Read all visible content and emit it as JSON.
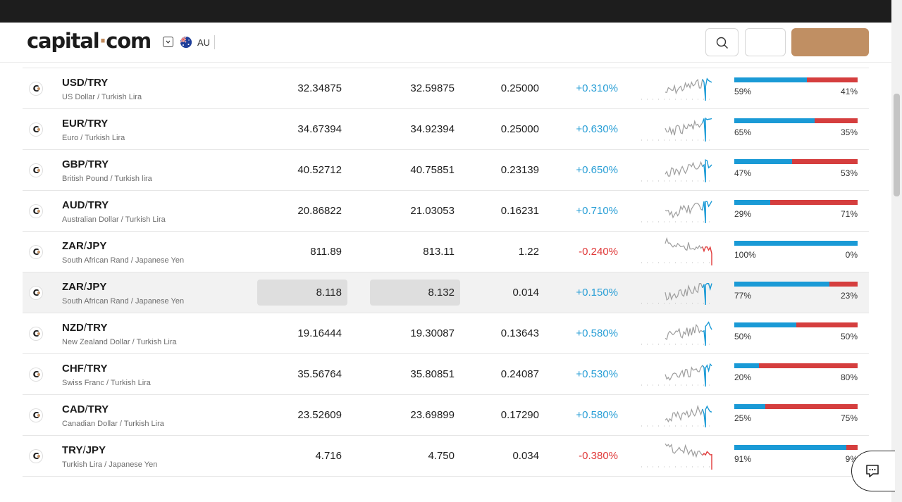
{
  "header": {
    "logo_main": "capital",
    "logo_dot": "·",
    "logo_tail": "com",
    "region": "AU"
  },
  "rows": [
    {
      "symbol_base": "USD",
      "symbol_quote": "TRY",
      "name": "US Dollar / Turkish Lira",
      "sell": "32.34875",
      "buy": "32.59875",
      "spread": "0.25000",
      "change": "+0.310%",
      "direction": "up",
      "buyers_pct": 59,
      "buyers_label": "59%",
      "sellers_label": "41%",
      "sparkline": "up"
    },
    {
      "symbol_base": "EUR",
      "symbol_quote": "TRY",
      "name": "Euro / Turkish Lira",
      "sell": "34.67394",
      "buy": "34.92394",
      "spread": "0.25000",
      "change": "+0.630%",
      "direction": "up",
      "buyers_pct": 65,
      "buyers_label": "65%",
      "sellers_label": "35%",
      "sparkline": "up"
    },
    {
      "symbol_base": "GBP",
      "symbol_quote": "TRY",
      "name": "British Pound / Turkish lira",
      "sell": "40.52712",
      "buy": "40.75851",
      "spread": "0.23139",
      "change": "+0.650%",
      "direction": "up",
      "buyers_pct": 47,
      "buyers_label": "47%",
      "sellers_label": "53%",
      "sparkline": "up"
    },
    {
      "symbol_base": "AUD",
      "symbol_quote": "TRY",
      "name": "Australian Dollar / Turkish Lira",
      "sell": "20.86822",
      "buy": "21.03053",
      "spread": "0.16231",
      "change": "+0.710%",
      "direction": "up",
      "buyers_pct": 29,
      "buyers_label": "29%",
      "sellers_label": "71%",
      "sparkline": "up"
    },
    {
      "symbol_base": "ZAR",
      "symbol_quote": "JPY",
      "name": "South African Rand / Japanese Yen",
      "sell": "811.89",
      "buy": "813.11",
      "spread": "1.22",
      "change": "-0.240%",
      "direction": "down",
      "buyers_pct": 100,
      "buyers_label": "100%",
      "sellers_label": "0%",
      "sparkline": "down"
    },
    {
      "symbol_base": "ZAR",
      "symbol_quote": "JPY",
      "name": "South African Rand / Japanese Yen",
      "sell": "8.118",
      "buy": "8.132",
      "spread": "0.014",
      "change": "+0.150%",
      "direction": "up",
      "buyers_pct": 77,
      "buyers_label": "77%",
      "sellers_label": "23%",
      "sparkline": "up",
      "highlighted": true
    },
    {
      "symbol_base": "NZD",
      "symbol_quote": "TRY",
      "name": "New Zealand Dollar / Turkish Lira",
      "sell": "19.16444",
      "buy": "19.30087",
      "spread": "0.13643",
      "change": "+0.580%",
      "direction": "up",
      "buyers_pct": 50,
      "buyers_label": "50%",
      "sellers_label": "50%",
      "sparkline": "up"
    },
    {
      "symbol_base": "CHF",
      "symbol_quote": "TRY",
      "name": "Swiss Franc / Turkish Lira",
      "sell": "35.56764",
      "buy": "35.80851",
      "spread": "0.24087",
      "change": "+0.530%",
      "direction": "up",
      "buyers_pct": 20,
      "buyers_label": "20%",
      "sellers_label": "80%",
      "sparkline": "up"
    },
    {
      "symbol_base": "CAD",
      "symbol_quote": "TRY",
      "name": "Canadian Dollar / Turkish Lira",
      "sell": "23.52609",
      "buy": "23.69899",
      "spread": "0.17290",
      "change": "+0.580%",
      "direction": "up",
      "buyers_pct": 25,
      "buyers_label": "25%",
      "sellers_label": "75%",
      "sparkline": "up"
    },
    {
      "symbol_base": "TRY",
      "symbol_quote": "JPY",
      "name": "Turkish Lira / Japanese Yen",
      "sell": "4.716",
      "buy": "4.750",
      "spread": "0.034",
      "change": "-0.380%",
      "direction": "down",
      "buyers_pct": 91,
      "buyers_label": "91%",
      "sellers_label": "9%",
      "sparkline": "down"
    }
  ],
  "colors": {
    "brand": "#c08f63",
    "positive": "#2a9fd6",
    "negative": "#e03a3a",
    "buyers_bar": "#1a9ad6",
    "sellers_bar": "#d53e3e"
  },
  "icons": {
    "search": "search-icon",
    "region_toggle": "chevron-down-icon",
    "flag": "australia-flag-icon",
    "chat": "chat-icon",
    "market_logo": "capital-com-logo-icon"
  }
}
